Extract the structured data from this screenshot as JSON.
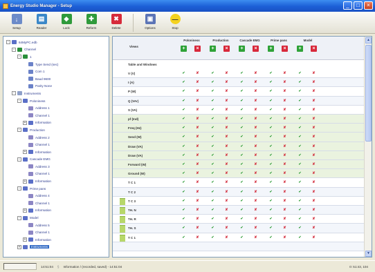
{
  "window": {
    "title": "Energy Studio Manager - Setup"
  },
  "toolbar": [
    {
      "label": "Setup",
      "icon": "arrow-down-icon",
      "color": "#6c8bc9"
    },
    {
      "label": "Reader",
      "icon": "reader-icon",
      "color": "#3a87c8"
    },
    {
      "label": "Lock",
      "icon": "lock-icon",
      "color": "#2f9a3b"
    },
    {
      "label": "Reform",
      "icon": "reform-icon",
      "color": "#2f9a3b"
    },
    {
      "label": "Delete",
      "icon": "delete-icon",
      "color": "#d62a3a"
    },
    {
      "label": "Options",
      "icon": "options-icon",
      "color": "#5b74b6"
    },
    {
      "label": "Stop",
      "icon": "stop-icon",
      "color": "#f4d21f"
    }
  ],
  "tree": [
    {
      "depth": 0,
      "label": "64MyPC.edb",
      "expander": "-",
      "icon": "#5a6fc7"
    },
    {
      "depth": 1,
      "label": "Channel",
      "expander": "-",
      "icon": "#2a8f3a"
    },
    {
      "depth": 2,
      "label": "1",
      "expander": "-",
      "icon": "#2a8f3a"
    },
    {
      "depth": 3,
      "label": "Type Send (sec)",
      "expander": "",
      "icon": "#6b82c8"
    },
    {
      "depth": 3,
      "label": "Com 1",
      "expander": "",
      "icon": "#6b82c8"
    },
    {
      "depth": 3,
      "label": "Baud 9600",
      "expander": "",
      "icon": "#6b82c8"
    },
    {
      "depth": 3,
      "label": "Parity None",
      "expander": "",
      "icon": "#6b82c8"
    },
    {
      "depth": 1,
      "label": "Instruments",
      "expander": "-",
      "icon": "#8ea0c9"
    },
    {
      "depth": 2,
      "label": "Poloniness",
      "expander": "-",
      "icon": "#5a6fc7"
    },
    {
      "depth": 3,
      "label": "Address 1",
      "expander": "",
      "icon": "#8c86c4"
    },
    {
      "depth": 3,
      "label": "Channel 1",
      "expander": "",
      "icon": "#8c86c4"
    },
    {
      "depth": 3,
      "label": "Information",
      "expander": "+",
      "icon": "#5a6fc7"
    },
    {
      "depth": 2,
      "label": "Production",
      "expander": "-",
      "icon": "#5a6fc7"
    },
    {
      "depth": 3,
      "label": "Address 2",
      "expander": "",
      "icon": "#8c86c4"
    },
    {
      "depth": 3,
      "label": "Channel 1",
      "expander": "",
      "icon": "#8c86c4"
    },
    {
      "depth": 3,
      "label": "Information",
      "expander": "+",
      "icon": "#5a6fc7"
    },
    {
      "depth": 2,
      "label": "Cascade EMG",
      "expander": "-",
      "icon": "#5a6fc7"
    },
    {
      "depth": 3,
      "label": "Address 3",
      "expander": "",
      "icon": "#8c86c4"
    },
    {
      "depth": 3,
      "label": "Channel 1",
      "expander": "",
      "icon": "#8c86c4"
    },
    {
      "depth": 3,
      "label": "Information",
      "expander": "+",
      "icon": "#5a6fc7"
    },
    {
      "depth": 2,
      "label": "Prime pans",
      "expander": "-",
      "icon": "#5a6fc7"
    },
    {
      "depth": 3,
      "label": "Address 4",
      "expander": "",
      "icon": "#8c86c4"
    },
    {
      "depth": 3,
      "label": "Channel 1",
      "expander": "",
      "icon": "#8c86c4"
    },
    {
      "depth": 3,
      "label": "Information",
      "expander": "+",
      "icon": "#5a6fc7"
    },
    {
      "depth": 2,
      "label": "Model",
      "expander": "-",
      "icon": "#5a6fc7"
    },
    {
      "depth": 3,
      "label": "Address 5",
      "expander": "",
      "icon": "#8c86c4"
    },
    {
      "depth": 3,
      "label": "Channel 1",
      "expander": "",
      "icon": "#8c86c4"
    },
    {
      "depth": 3,
      "label": "Information",
      "expander": "+",
      "icon": "#5a6fc7"
    },
    {
      "depth": 2,
      "label": "Instruments",
      "expander": "+",
      "icon": "#5a6fc7",
      "selected": true
    }
  ],
  "grid": {
    "corner_label": "Views",
    "groups": [
      "Poloniness",
      "Production",
      "Cascade EMG",
      "Prime pans",
      "Model"
    ],
    "subheader": "Table and Windows",
    "rows": [
      {
        "label": "V (V)",
        "vals": [
          "g",
          "r",
          "g",
          "r",
          "g",
          "r",
          "g",
          "r",
          "g",
          "r"
        ]
      },
      {
        "label": "I (A)",
        "vals": [
          "g",
          "r",
          "g",
          "r",
          "g",
          "r",
          "g",
          "r",
          "g",
          "r"
        ]
      },
      {
        "label": "P (W)",
        "vals": [
          "g",
          "r",
          "g",
          "r",
          "g",
          "r",
          "g",
          "r",
          "g",
          "r"
        ]
      },
      {
        "label": "Q (VAr)",
        "vals": [
          "g",
          "r",
          "g",
          "r",
          "g",
          "r",
          "g",
          "r",
          "g",
          "r"
        ]
      },
      {
        "label": "S (VA)",
        "vals": [
          "g",
          "r",
          "g",
          "r",
          "g",
          "r",
          "g",
          "r",
          "g",
          "r"
        ]
      },
      {
        "label": "pf (Ind)",
        "vals": [
          "g",
          "r",
          "g",
          "r",
          "g",
          "r",
          "g",
          "r",
          "g",
          "r"
        ]
      },
      {
        "label": "Freq (Hz)",
        "vals": [
          "g",
          "r",
          "g",
          "r",
          "g",
          "r",
          "g",
          "r",
          "g",
          "r"
        ]
      },
      {
        "label": "Send (W)",
        "vals": [
          "g",
          "r",
          "g",
          "r",
          "g",
          "r",
          "g",
          "r",
          "g",
          "r"
        ]
      },
      {
        "label": "Draw (VA)",
        "vals": [
          "g",
          "r",
          "g",
          "r",
          "g",
          "r",
          "g",
          "r",
          "g",
          "r"
        ]
      },
      {
        "label": "Draw (VA)",
        "vals": [
          "g",
          "r",
          "g",
          "r",
          "g",
          "r",
          "g",
          "r",
          "g",
          "r"
        ]
      },
      {
        "label": "Forward (W)",
        "vals": [
          "g",
          "r",
          "g",
          "r",
          "g",
          "r",
          "g",
          "r",
          "g",
          "r"
        ]
      },
      {
        "label": "Ground (W)",
        "vals": [
          "g",
          "r",
          "g",
          "r",
          "g",
          "r",
          "g",
          "r",
          "g",
          "r"
        ]
      },
      {
        "label": "T C 1",
        "vals": [
          "g",
          "r",
          "g",
          "r",
          "g",
          "r",
          "g",
          "r",
          "g",
          "r"
        ]
      },
      {
        "label": "T C 2",
        "vals": [
          "g",
          "r",
          "g",
          "r",
          "g",
          "r",
          "g",
          "r",
          "g",
          "r"
        ]
      },
      {
        "label": "T C 3",
        "vals": [
          "g",
          "r",
          "g",
          "r",
          "g",
          "r",
          "g",
          "r",
          "g",
          "r"
        ]
      },
      {
        "label": "TH. N",
        "vals": [
          "g",
          "r",
          "g",
          "r",
          "g",
          "r",
          "g",
          "r",
          "g",
          "r"
        ]
      },
      {
        "label": "TH. R",
        "vals": [
          "g",
          "r",
          "g",
          "r",
          "g",
          "r",
          "g",
          "r",
          "g",
          "r"
        ]
      },
      {
        "label": "TH. S",
        "vals": [
          "g",
          "r",
          "g",
          "r",
          "g",
          "r",
          "g",
          "r",
          "g",
          "r"
        ]
      },
      {
        "label": "T C 1",
        "vals": [
          "g",
          "r",
          "g",
          "r",
          "g",
          "r",
          "g",
          "r",
          "g",
          "r"
        ]
      },
      {
        "label": "",
        "vals": [
          "",
          "",
          "",
          "",
          "",
          "",
          "",
          "",
          "",
          ""
        ]
      }
    ]
  },
  "status": {
    "time": "14:51:04",
    "message": "Information / (recorded, saved) - 14:51:04",
    "right": "0: 51:43, 104"
  }
}
